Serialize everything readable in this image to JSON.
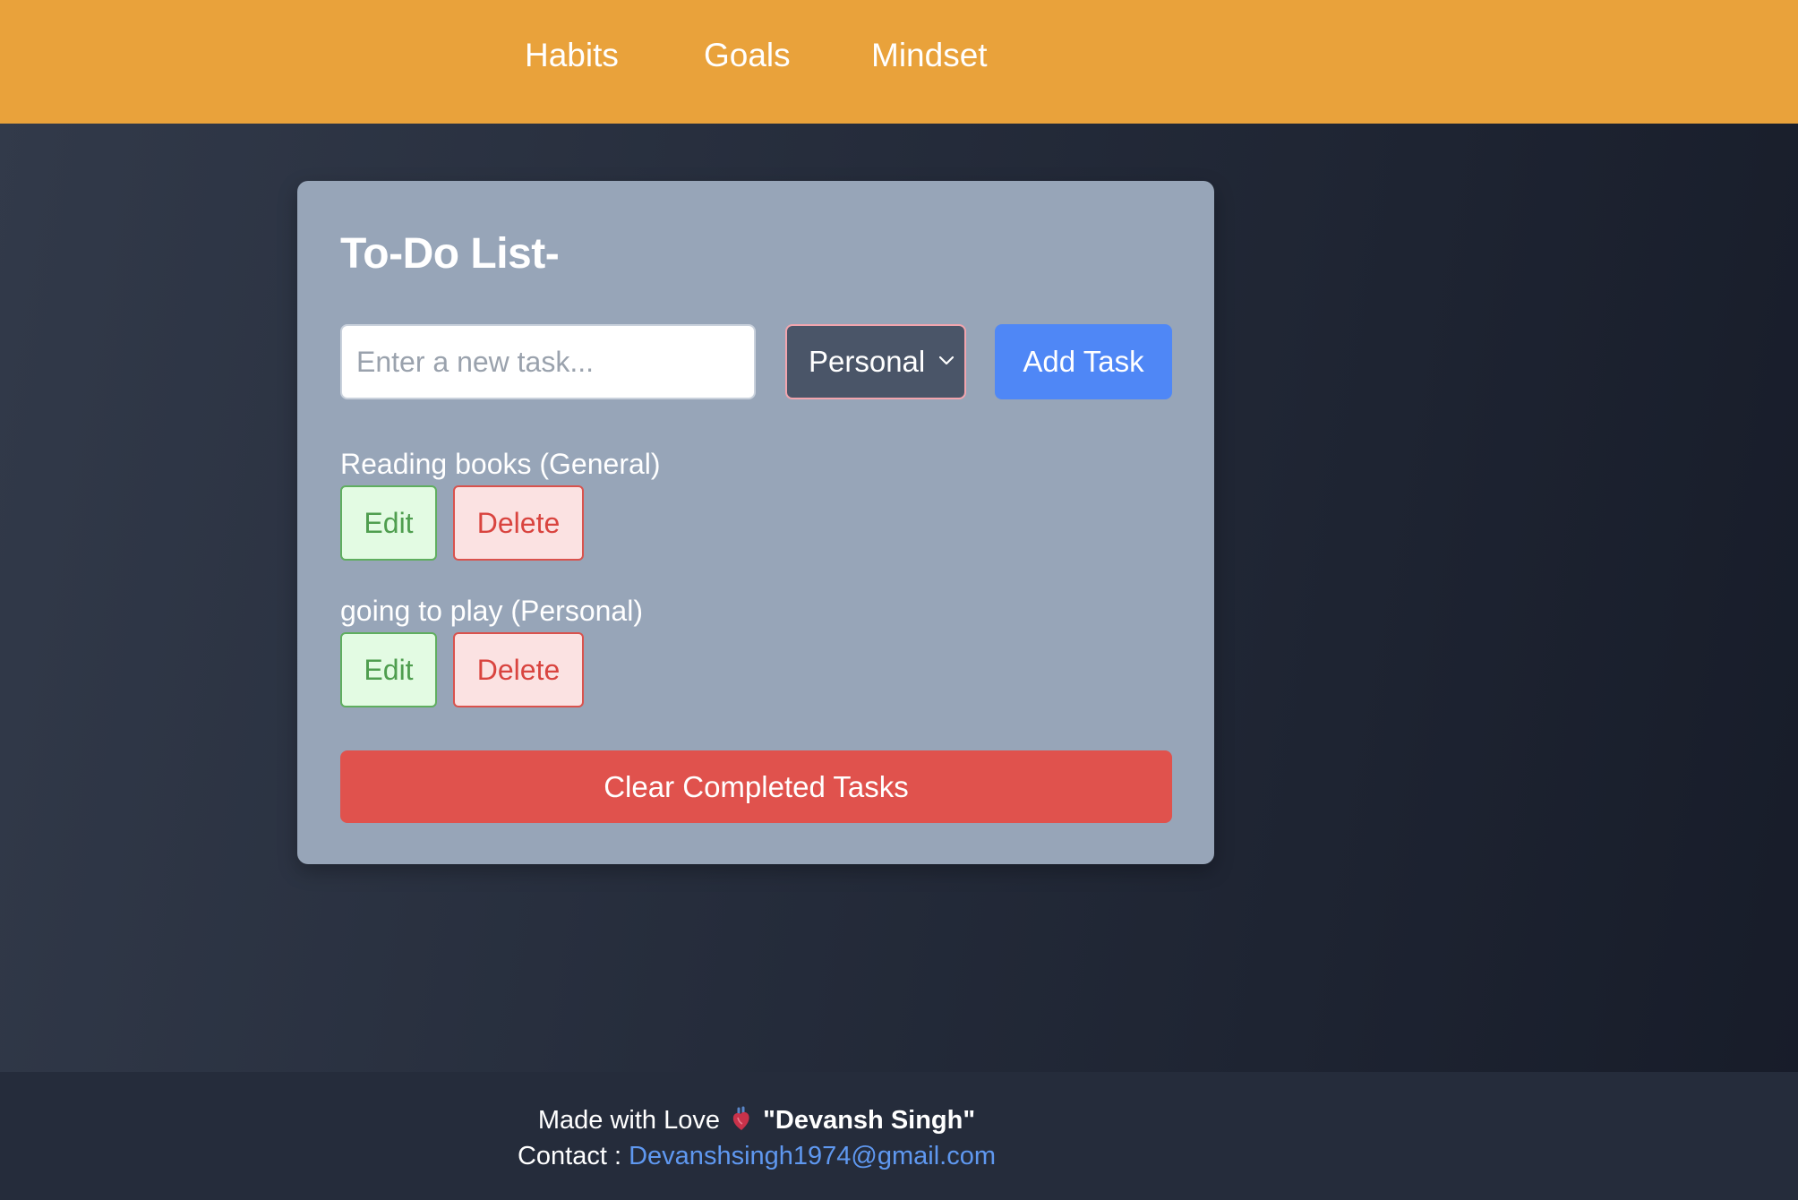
{
  "nav": {
    "links": [
      "Habits",
      "Goals",
      "Mindset"
    ]
  },
  "todo": {
    "title": "To-Do List-",
    "input_placeholder": "Enter a new task...",
    "input_value": "",
    "category_selected": "Personal",
    "add_button_label": "Add Task",
    "tasks": [
      {
        "label": "Reading books (General)",
        "edit_label": "Edit",
        "delete_label": "Delete"
      },
      {
        "label": "going to play (Personal)",
        "edit_label": "Edit",
        "delete_label": "Delete"
      }
    ],
    "clear_button_label": "Clear Completed Tasks"
  },
  "footer": {
    "made_with": "Made with Love",
    "heart_icon": "anatomical-heart-icon",
    "author": "\"Devansh Singh\"",
    "contact_label": "Contact :",
    "email": "Devanshsingh1974@gmail.com"
  },
  "colors": {
    "nav_bg": "#e9a23b",
    "card_bg": "#97a5b8",
    "add_button": "#4f87f6",
    "clear_button": "#e0524d",
    "link": "#5f98f0"
  }
}
